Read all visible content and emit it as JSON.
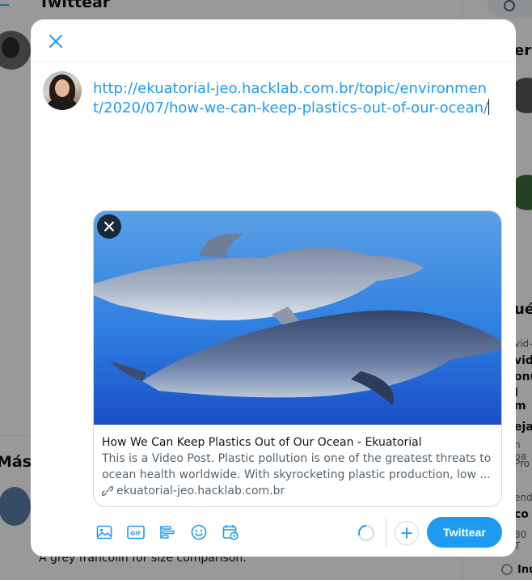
{
  "background": {
    "header_title": "Twittear",
    "right_heading_1": "ers",
    "right_heading_2": "ué",
    "right_snippets": [
      "vid-",
      "vid",
      "onu",
      "l m",
      "eja",
      "n pa",
      "Pro",
      "ende",
      "co",
      "80 T"
    ],
    "section_title": "Más T",
    "caption": "A grey francolin for size comparison.",
    "radio_label": "Inu"
  },
  "compose": {
    "tweet_text": "http://ekuatorial-jeo.hacklab.com.br/topic/environment/2020/07/how-we-can-keep-plastics-out-of-our-ocean/",
    "link_card": {
      "title": "How We Can Keep Plastics Out of Our Ocean - Ekuatorial",
      "description": "This is a Video Post. Plastic pollution is one of the greatest threats to ocean health worldwide. With skyrocketing plastic production, low ...",
      "domain": "ekuatorial-jeo.hacklab.com.br"
    },
    "toolbar_icons": [
      "image-icon",
      "gif-icon",
      "poll-icon",
      "emoji-icon",
      "schedule-icon"
    ],
    "gif_label": "GIF",
    "tweet_button": "Twittear"
  },
  "colors": {
    "accent": "#1d9bf0",
    "text": "#0f1419",
    "secondary": "#536471"
  }
}
